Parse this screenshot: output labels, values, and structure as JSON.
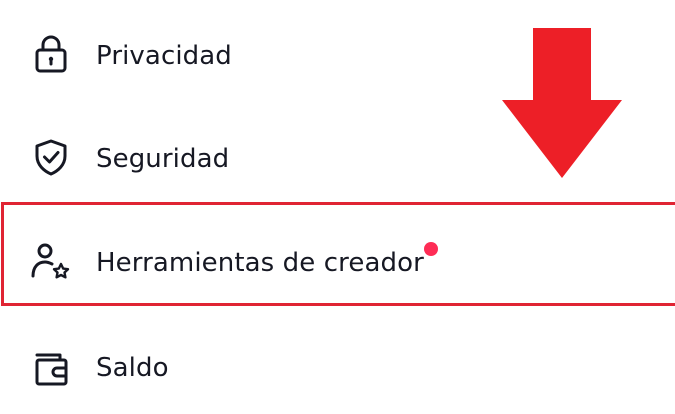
{
  "menu": {
    "items": [
      {
        "id": "privacy",
        "label": "Privacidad",
        "icon": "lock-icon"
      },
      {
        "id": "security",
        "label": "Seguridad",
        "icon": "shield-check-icon"
      },
      {
        "id": "creator_tools",
        "label": "Herramientas de creador",
        "icon": "user-star-icon",
        "has_notification_dot": true
      },
      {
        "id": "balance",
        "label": "Saldo",
        "icon": "wallet-icon"
      }
    ]
  },
  "annotation": {
    "highlighted_item": "creator_tools",
    "arrow_icon": "down-arrow-icon"
  },
  "colors": {
    "text": "#161823",
    "highlight": "#e02433",
    "arrow": "#ed1f27",
    "notification_dot": "#fe2c55",
    "background": "#ffffff"
  }
}
